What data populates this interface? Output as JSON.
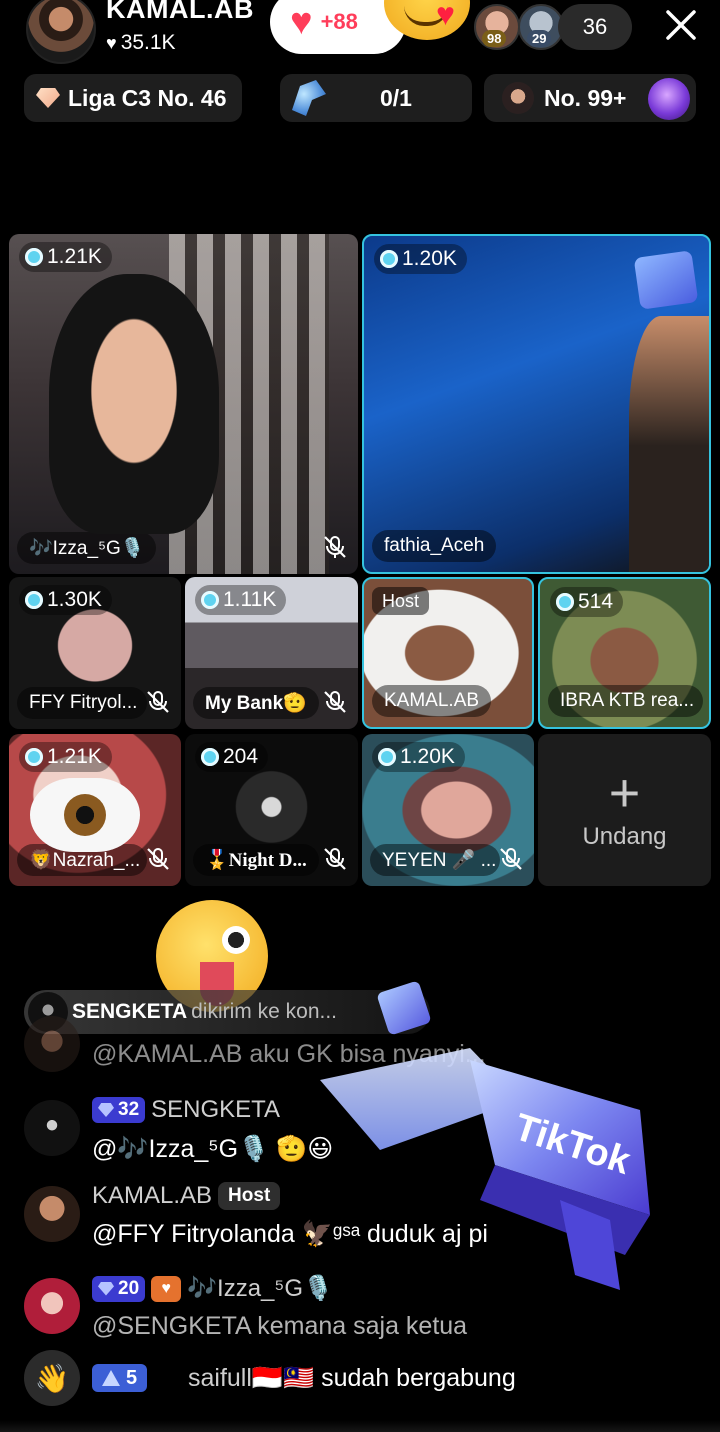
{
  "header": {
    "host_name": "KAMAL.AB",
    "host_likes": "35.1K",
    "follow_count": "+88",
    "viewer_badges": [
      "98",
      "29"
    ],
    "viewer_count": "36"
  },
  "stats": {
    "league": "Liga C3 No. 46",
    "goal": "0/1",
    "rank": "No. 99+"
  },
  "tiles": [
    {
      "score": "1.21K",
      "name": "🎶Izza_⁵G🎙️",
      "muted": true
    },
    {
      "score": "1.20K",
      "name": "fathia_Aceh",
      "muted": false
    },
    {
      "score": "1.30K",
      "name": "FFY Fitryol...",
      "muted": true
    },
    {
      "score": "1.11K",
      "name": "My Bank🫡",
      "muted": true
    },
    {
      "host_tag": "Host",
      "name": "KAMAL.AB",
      "muted": false
    },
    {
      "score": "514",
      "name": "IBRA KTB rea...",
      "muted": false
    },
    {
      "score": "1.21K",
      "name": "🦁Nazrah_...",
      "muted": true
    },
    {
      "score": "204",
      "name": "🎖️Night D...",
      "muted": true
    },
    {
      "score": "1.20K",
      "name": "YEYEN 🎤 ...",
      "muted": true
    }
  ],
  "invite": {
    "label": "Undang"
  },
  "gift_banner": {
    "name": "SENGKETA",
    "text": "dikirim ke kon..."
  },
  "chat": [
    {
      "user": "",
      "text": "@KAMAL.AB aku GK bisa nyanyi..."
    },
    {
      "level": "32",
      "user": "SENGKETA",
      "text": "@🎶Izza_⁵G🎙️ 🫡😃"
    },
    {
      "user": "KAMAL.AB",
      "badge": "Host",
      "text": "@FFY Fitryolanda 🦅ᵍˢᵃ duduk  aj pi"
    },
    {
      "level": "20",
      "user": "🎶Izza_⁵G🎙️",
      "text": "@SENGKETA kemana saja ketua"
    }
  ],
  "join": {
    "level": "5",
    "user": "saifull🇮🇩🇲🇾",
    "text": "sudah bergabung"
  },
  "colors": {
    "accent": "#35c3df",
    "like": "#ff3d5a",
    "level_badge": "#3b3bd0"
  }
}
